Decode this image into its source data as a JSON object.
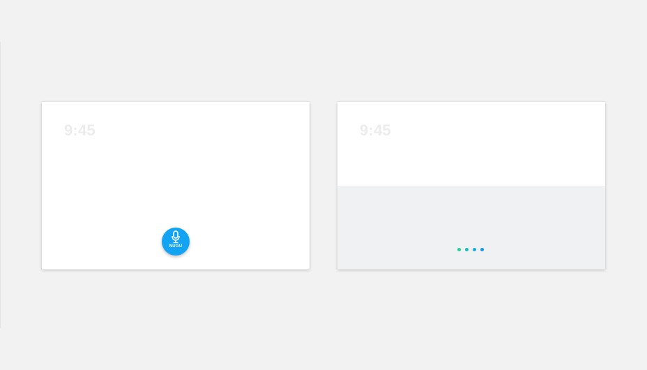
{
  "screen_idle": {
    "time": "9:45",
    "voice_button": {
      "label": "NUGU",
      "icon": "microphone-icon",
      "color": "#12a3f3"
    }
  },
  "screen_listening": {
    "time": "9:45",
    "panel_color": "#f0f1f2",
    "indicator": {
      "icon": "listening-dots",
      "dot_colors": [
        "#1ed29a",
        "#14bcc0",
        "#12aee0",
        "#1598f0"
      ]
    }
  },
  "colors": {
    "background": "#f2f2f2",
    "screen": "#ffffff",
    "clock_text": "#ececec"
  }
}
